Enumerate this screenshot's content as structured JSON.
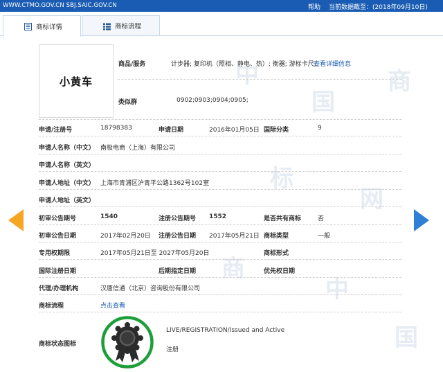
{
  "topbar": {
    "site": "WWW.CTMO.GOV.CN SBJ.SAIC.GOV.CN",
    "help": "帮助",
    "cutoff": "当前数据截至：(2018年09月10日)"
  },
  "tabs": [
    {
      "label": "商标详情",
      "active": true
    },
    {
      "label": "商标流程",
      "active": false
    }
  ],
  "watermark_text": [
    "中",
    "国",
    "商",
    "标",
    "网"
  ],
  "trademark_name": "小黄车",
  "goods": {
    "label": "商品/服务",
    "value": "计步器; 复印机（照相、静电、热）; 衡器; 游标卡尺;",
    "more_link": "查看详细信息"
  },
  "similar_group": {
    "label": "类似群",
    "value": "0902;0903;0904;0905;"
  },
  "fields": {
    "app_no_label": "申请/注册号",
    "app_no": "18798383",
    "app_date_label": "申请日期",
    "app_date": "2016年01月05日",
    "intl_class_label": "国际分类",
    "intl_class": "9",
    "applicant_cn_label": "申请人名称（中文）",
    "applicant_cn": "南极电商（上海）有限公司",
    "applicant_en_label": "申请人名称（英文）",
    "applicant_en": "",
    "address_cn_label": "申请人地址（中文）",
    "address_cn": "上海市青浦区沪青平公路1362号102室",
    "address_en_label": "申请人地址（英文）",
    "address_en": "",
    "prelim_no_label": "初审公告期号",
    "prelim_no": "1540",
    "reg_notice_no_label": "注册公告期号",
    "reg_notice_no": "1552",
    "shared_label": "是否共有商标",
    "shared": "否",
    "prelim_date_label": "初审公告日期",
    "prelim_date": "2017年02月20日",
    "reg_notice_date_label": "注册公告日期",
    "reg_notice_date": "2017年05月21日",
    "tm_type_label": "商标类型",
    "tm_type": "一般",
    "exclusive_label": "专用权期限",
    "exclusive": "2017年05月21日至 2027年05月20日",
    "tm_form_label": "商标形式",
    "tm_form": "",
    "intl_reg_date_label": "国际注册日期",
    "intl_reg_date": "",
    "later_date_label": "后期指定日期",
    "later_date": "",
    "priority_label": "优先权日期",
    "priority": "",
    "agent_label": "代理/办理机构",
    "agent": "汉唐信通（北京）咨询股份有限公司",
    "process_label": "商标流程",
    "process_link": "点击查看",
    "status_label": "商标状态图标",
    "status_en": "LIVE/REGISTRATION/Issued and Active",
    "status_cn": "注册"
  },
  "colors": {
    "topbar": "#1a5cb3",
    "link": "#1a5cb3",
    "arrow_left": "#f5a623",
    "arrow_right": "#2f7fd6",
    "status_ring": "#1e9e3a"
  },
  "icons": [
    "list-icon",
    "process-icon",
    "prev-arrow-icon",
    "next-arrow-icon",
    "rosette-icon"
  ]
}
